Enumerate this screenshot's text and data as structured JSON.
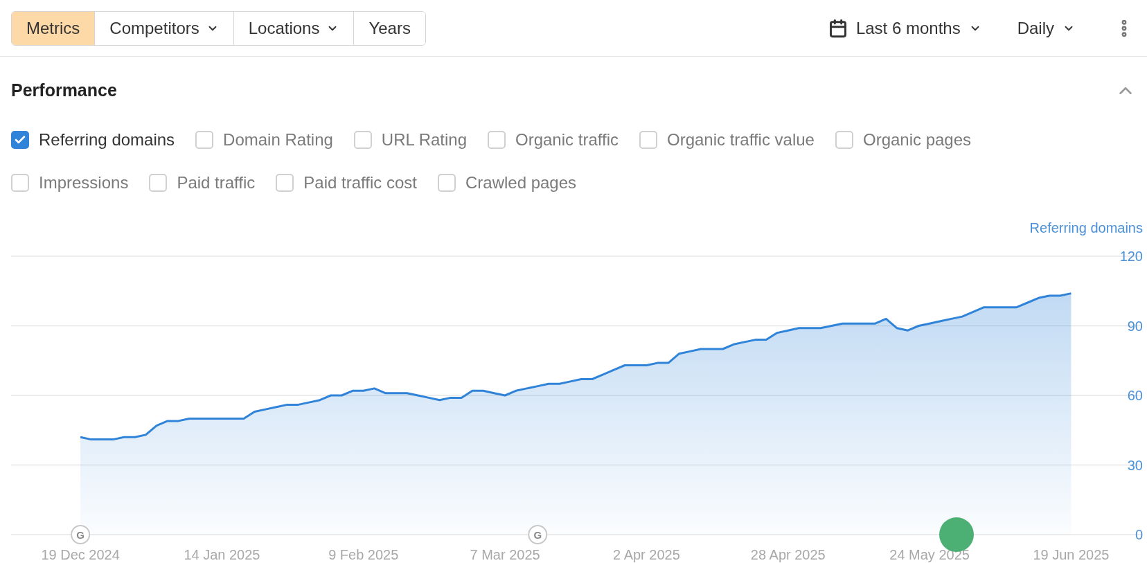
{
  "toolbar": {
    "segments": [
      {
        "label": "Metrics",
        "selected": true,
        "dropdown": false
      },
      {
        "label": "Competitors",
        "selected": false,
        "dropdown": true
      },
      {
        "label": "Locations",
        "selected": false,
        "dropdown": true
      },
      {
        "label": "Years",
        "selected": false,
        "dropdown": false
      }
    ],
    "period": {
      "label": "Last 6 months"
    },
    "interval": {
      "label": "Daily"
    }
  },
  "performance": {
    "title": "Performance",
    "expanded": true,
    "metrics": [
      {
        "label": "Referring domains",
        "checked": true
      },
      {
        "label": "Domain Rating",
        "checked": false
      },
      {
        "label": "URL Rating",
        "checked": false
      },
      {
        "label": "Organic traffic",
        "checked": false
      },
      {
        "label": "Organic traffic value",
        "checked": false
      },
      {
        "label": "Organic pages",
        "checked": false
      },
      {
        "label": "Impressions",
        "checked": false
      },
      {
        "label": "Paid traffic",
        "checked": false
      },
      {
        "label": "Paid traffic cost",
        "checked": false
      },
      {
        "label": "Crawled pages",
        "checked": false
      }
    ],
    "chart_data": {
      "type": "area",
      "categories": [
        "19 Dec 2024",
        null,
        null,
        null,
        null,
        null,
        null,
        null,
        null,
        null,
        null,
        null,
        null,
        "14 Jan 2025",
        null,
        null,
        null,
        null,
        null,
        null,
        null,
        null,
        null,
        null,
        null,
        null,
        "9 Feb 2025",
        null,
        null,
        null,
        null,
        null,
        null,
        null,
        null,
        null,
        null,
        null,
        null,
        "7 Mar 2025",
        null,
        null,
        null,
        null,
        null,
        null,
        null,
        null,
        null,
        null,
        null,
        null,
        "2 Apr 2025",
        null,
        null,
        null,
        null,
        null,
        null,
        null,
        null,
        null,
        null,
        null,
        null,
        "28 Apr 2025",
        null,
        null,
        null,
        null,
        null,
        null,
        null,
        null,
        null,
        null,
        null,
        null,
        "24 May 2025",
        null,
        null,
        null,
        null,
        null,
        null,
        null,
        null,
        null,
        null,
        null,
        null,
        "19 Jun 2025"
      ],
      "series": [
        {
          "name": "Referring domains",
          "color": "#2f83d8",
          "values": [
            42,
            41,
            41,
            41,
            42,
            42,
            43,
            47,
            49,
            49,
            50,
            50,
            50,
            50,
            50,
            50,
            53,
            54,
            55,
            56,
            56,
            57,
            58,
            60,
            60,
            62,
            62,
            63,
            61,
            61,
            61,
            60,
            59,
            58,
            59,
            59,
            62,
            62,
            61,
            60,
            62,
            63,
            64,
            65,
            65,
            66,
            67,
            67,
            69,
            71,
            73,
            73,
            73,
            74,
            74,
            78,
            79,
            80,
            80,
            80,
            82,
            83,
            84,
            84,
            87,
            88,
            89,
            89,
            89,
            90,
            91,
            91,
            91,
            91,
            93,
            89,
            88,
            90,
            91,
            92,
            93,
            94,
            96,
            98,
            98,
            98,
            98,
            100,
            102,
            103,
            103,
            104
          ]
        }
      ],
      "ylim": [
        0,
        120
      ],
      "yticks": [
        0,
        30,
        60,
        90,
        120
      ],
      "grid": true
    },
    "chart_markers": [
      {
        "kind": "update",
        "text": "G"
      },
      {
        "kind": "update",
        "text": "G"
      },
      {
        "kind": "event",
        "color": "#4caf73"
      }
    ]
  }
}
